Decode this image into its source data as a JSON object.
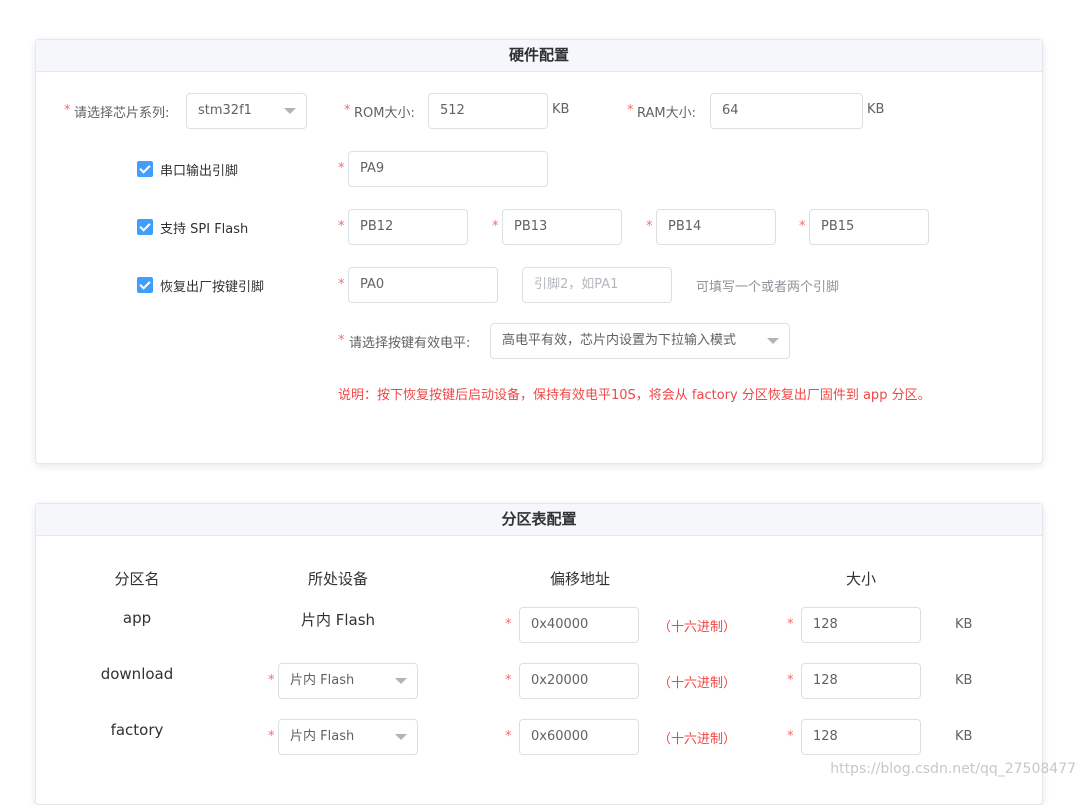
{
  "hardware": {
    "title": "硬件配置",
    "chip_series": {
      "label": "请选择芯片系列:",
      "value": "stm32f1"
    },
    "rom": {
      "label": "ROM大小:",
      "value": "512",
      "unit": "KB"
    },
    "ram": {
      "label": "RAM大小:",
      "value": "64",
      "unit": "KB"
    },
    "uart": {
      "label": "串口输出引脚",
      "value": "PA9"
    },
    "spi": {
      "label": "支持 SPI Flash",
      "pins": [
        "PB12",
        "PB13",
        "PB14",
        "PB15"
      ]
    },
    "reset": {
      "label": "恢复出厂按键引脚",
      "pin1": "PA0",
      "pin2_placeholder": "引脚2，如PA1",
      "hint": "可填写一个或者两个引脚"
    },
    "level": {
      "label": "请选择按键有效电平:",
      "value": "高电平有效，芯片内设置为下拉输入模式"
    },
    "note": "说明：按下恢复按键后启动设备，保持有效电平10S，将会从 factory 分区恢复出厂固件到 app 分区。"
  },
  "partition": {
    "title": "分区表配置",
    "headers": {
      "name": "分区名",
      "device": "所处设备",
      "offset": "偏移地址",
      "size": "大小"
    },
    "rows": [
      {
        "name": "app",
        "device": "片内 Flash",
        "offset": "0x40000",
        "size": "128"
      },
      {
        "name": "download",
        "device": "片内 Flash",
        "offset": "0x20000",
        "size": "128"
      },
      {
        "name": "factory",
        "device": "片内 Flash",
        "offset": "0x60000",
        "size": "128"
      }
    ],
    "hex_label": "（十六进制）",
    "unit": "KB"
  },
  "watermark": "https://blog.csdn.net/qq_27508477",
  "colors": {
    "accent": "#409eff",
    "required": "#f56c6c",
    "note": "#f04747"
  },
  "icons": {
    "checkbox": "checkmark-icon",
    "dropdown": "chevron-down-icon"
  }
}
